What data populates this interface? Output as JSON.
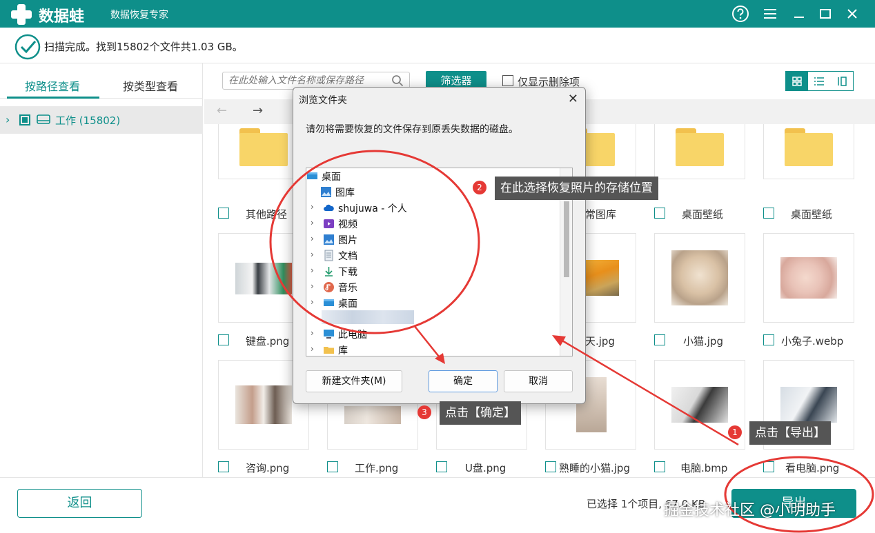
{
  "app": {
    "brand": "数据蛙",
    "subtitle": "数据恢复专家",
    "icons": [
      "help-icon",
      "menu-icon",
      "minimize-icon",
      "maximize-icon",
      "close-icon"
    ]
  },
  "status": {
    "text": "扫描完成。找到15802个文件共1.03 GB。"
  },
  "sidebar": {
    "tab_path": "按路径查看",
    "tab_type": "按类型查看",
    "tree_item": "工作 (15802)"
  },
  "toolbar": {
    "search_placeholder": "在此处输入文件名称或保存路径",
    "filter_label": "筛选器",
    "deleted_only_label": "仅显示删除项"
  },
  "files": {
    "row1": [
      "其他路径",
      "",
      "",
      "",
      "常图库",
      "桌面壁纸",
      "桌面壁纸"
    ],
    "row2": [
      "键盘.png",
      "",
      "",
      "",
      "天.jpg",
      "小猫.jpg",
      "小兔子.webp"
    ],
    "row3": [
      "咨询.png",
      "工作.png",
      "U盘.png",
      "熟睡的小猫.jpg",
      "电脑.bmp",
      "看电脑.png"
    ]
  },
  "bottom": {
    "back_label": "返回",
    "selection_info": "已选择 1个项目, 67.0 KB",
    "export_label": "导出"
  },
  "dialog": {
    "title": "浏览文件夹",
    "message": "请勿将需要恢复的文件保存到原丢失数据的磁盘。",
    "tree": [
      {
        "label": "桌面",
        "icon": "desktop-icon",
        "expander": ""
      },
      {
        "label": "图库",
        "icon": "gallery-icon",
        "expander": ""
      },
      {
        "label": "shujuwa - 个人",
        "icon": "cloud-icon",
        "expander": "›"
      },
      {
        "label": "视频",
        "icon": "video-icon",
        "expander": "›"
      },
      {
        "label": "图片",
        "icon": "picture-icon",
        "expander": "›"
      },
      {
        "label": "文档",
        "icon": "document-icon",
        "expander": "›"
      },
      {
        "label": "下载",
        "icon": "download-icon",
        "expander": "›"
      },
      {
        "label": "音乐",
        "icon": "music-icon",
        "expander": "›"
      },
      {
        "label": "桌面",
        "icon": "desktop-icon",
        "expander": "›"
      },
      {
        "label": "此电脑",
        "icon": "computer-icon",
        "expander": "›"
      },
      {
        "label": "库",
        "icon": "folder-icon",
        "expander": "›"
      }
    ],
    "new_folder_label": "新建文件夹(M)",
    "ok_label": "确定",
    "cancel_label": "取消"
  },
  "annotations": {
    "step1_num": "1",
    "step1_text": "点击【导出】",
    "step2_num": "2",
    "step2_text": "在此选择恢复照片的存储位置",
    "step3_num": "3",
    "step3_text": "点击【确定】",
    "color": "#e53935"
  },
  "watermark": "掘金技术社区 @小明助手",
  "colors": {
    "accent": "#0e8f8a",
    "folder": "#f8d568"
  }
}
